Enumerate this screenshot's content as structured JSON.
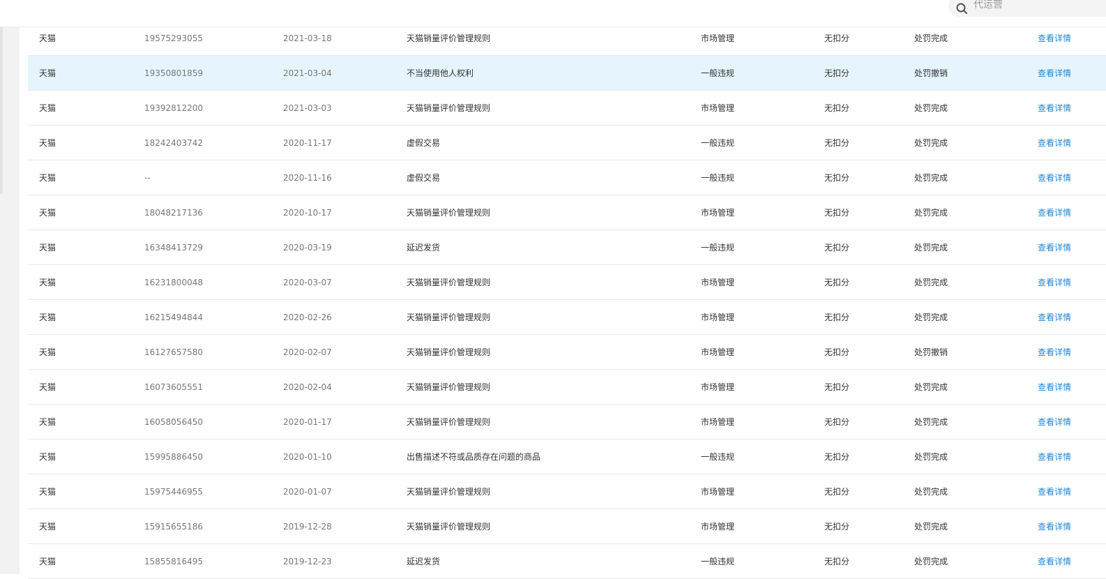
{
  "search": {
    "placeholder": "代运营"
  },
  "table": {
    "rows": [
      {
        "platform": "天猫",
        "id": "19575293055",
        "date": "2021-03-18",
        "rule": "天猫销量评价管理规则",
        "type": "市场管理",
        "points": "无扣分",
        "status": "处罚完成",
        "action": "查看详情"
      },
      {
        "platform": "天猫",
        "id": "19350801859",
        "date": "2021-03-04",
        "rule": "不当使用他人权利",
        "type": "一般违规",
        "points": "无扣分",
        "status": "处罚撤销",
        "action": "查看详情"
      },
      {
        "platform": "天猫",
        "id": "19392812200",
        "date": "2021-03-03",
        "rule": "天猫销量评价管理规则",
        "type": "市场管理",
        "points": "无扣分",
        "status": "处罚完成",
        "action": "查看详情"
      },
      {
        "platform": "天猫",
        "id": "18242403742",
        "date": "2020-11-17",
        "rule": "虚假交易",
        "type": "一般违规",
        "points": "无扣分",
        "status": "处罚完成",
        "action": "查看详情"
      },
      {
        "platform": "天猫",
        "id": "--",
        "date": "2020-11-16",
        "rule": "虚假交易",
        "type": "一般违规",
        "points": "无扣分",
        "status": "处罚完成",
        "action": "查看详情"
      },
      {
        "platform": "天猫",
        "id": "18048217136",
        "date": "2020-10-17",
        "rule": "天猫销量评价管理规则",
        "type": "市场管理",
        "points": "无扣分",
        "status": "处罚完成",
        "action": "查看详情"
      },
      {
        "platform": "天猫",
        "id": "16348413729",
        "date": "2020-03-19",
        "rule": "延迟发货",
        "type": "一般违规",
        "points": "无扣分",
        "status": "处罚完成",
        "action": "查看详情"
      },
      {
        "platform": "天猫",
        "id": "16231800048",
        "date": "2020-03-07",
        "rule": "天猫销量评价管理规则",
        "type": "市场管理",
        "points": "无扣分",
        "status": "处罚完成",
        "action": "查看详情"
      },
      {
        "platform": "天猫",
        "id": "16215494844",
        "date": "2020-02-26",
        "rule": "天猫销量评价管理规则",
        "type": "市场管理",
        "points": "无扣分",
        "status": "处罚完成",
        "action": "查看详情"
      },
      {
        "platform": "天猫",
        "id": "16127657580",
        "date": "2020-02-07",
        "rule": "天猫销量评价管理规则",
        "type": "市场管理",
        "points": "无扣分",
        "status": "处罚撤销",
        "action": "查看详情"
      },
      {
        "platform": "天猫",
        "id": "16073605551",
        "date": "2020-02-04",
        "rule": "天猫销量评价管理规则",
        "type": "市场管理",
        "points": "无扣分",
        "status": "处罚完成",
        "action": "查看详情"
      },
      {
        "platform": "天猫",
        "id": "16058056450",
        "date": "2020-01-17",
        "rule": "天猫销量评价管理规则",
        "type": "市场管理",
        "points": "无扣分",
        "status": "处罚完成",
        "action": "查看详情"
      },
      {
        "platform": "天猫",
        "id": "15995886450",
        "date": "2020-01-10",
        "rule": "出售描述不符或品质存在问题的商品",
        "type": "一般违规",
        "points": "无扣分",
        "status": "处罚完成",
        "action": "查看详情"
      },
      {
        "platform": "天猫",
        "id": "15975446955",
        "date": "2020-01-07",
        "rule": "天猫销量评价管理规则",
        "type": "市场管理",
        "points": "无扣分",
        "status": "处罚完成",
        "action": "查看详情"
      },
      {
        "platform": "天猫",
        "id": "15915655186",
        "date": "2019-12-28",
        "rule": "天猫销量评价管理规则",
        "type": "市场管理",
        "points": "无扣分",
        "status": "处罚完成",
        "action": "查看详情"
      },
      {
        "platform": "天猫",
        "id": "15855816495",
        "date": "2019-12-23",
        "rule": "延迟发货",
        "type": "一般违规",
        "points": "无扣分",
        "status": "处罚完成",
        "action": "查看详情"
      }
    ]
  }
}
